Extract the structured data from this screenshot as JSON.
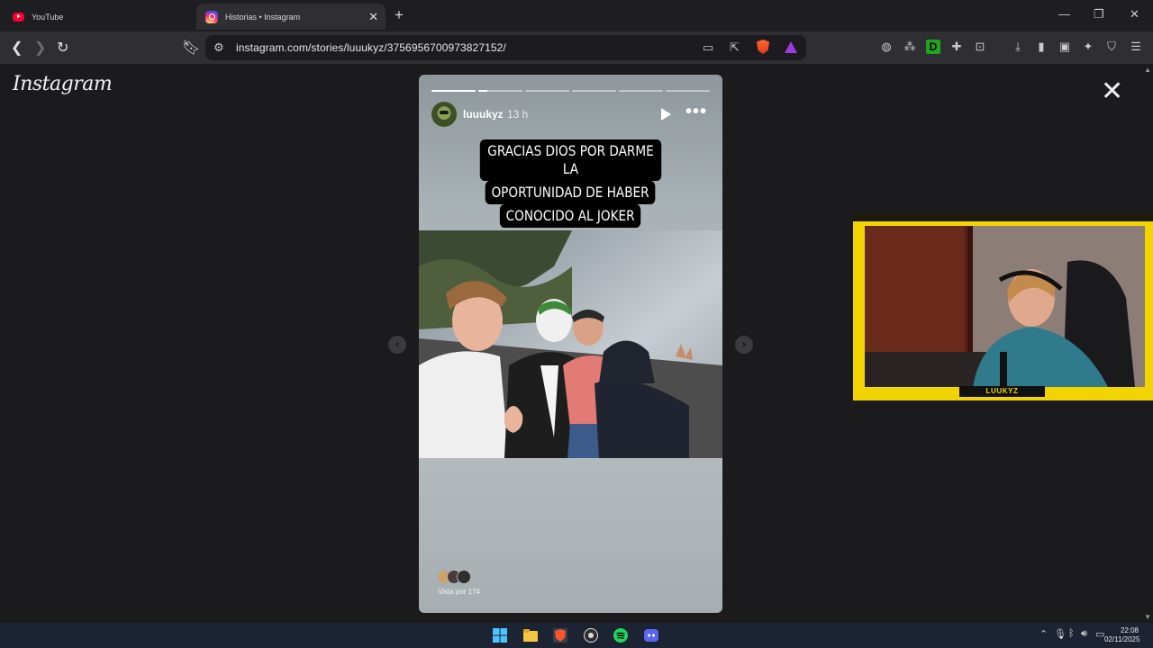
{
  "browser": {
    "tabs": [
      {
        "title": "YouTube",
        "active": false
      },
      {
        "title": "Historias • Instagram",
        "active": true
      }
    ],
    "url": "instagram.com/stories/luuukyz/3756956700973827152/"
  },
  "page": {
    "logo": "Instagram"
  },
  "story": {
    "username": "luuukyz",
    "time": "13 h",
    "progress_segments": [
      1,
      0.2,
      0,
      0,
      0,
      0
    ],
    "caption_lines": [
      "GRACIAS DIOS POR DARME LA",
      "OPORTUNIDAD DE HABER",
      "CONOCIDO AL JOKER"
    ],
    "viewed_by": "Vista por 174"
  },
  "webcam": {
    "label": "LUUKYZ"
  },
  "taskbar": {
    "time": "22:08",
    "date": "02/11/2025"
  },
  "colors": {
    "webcam_frame": "#f1d400",
    "brave_orange": "#ff6a2b",
    "spotify_green": "#1ed760"
  }
}
